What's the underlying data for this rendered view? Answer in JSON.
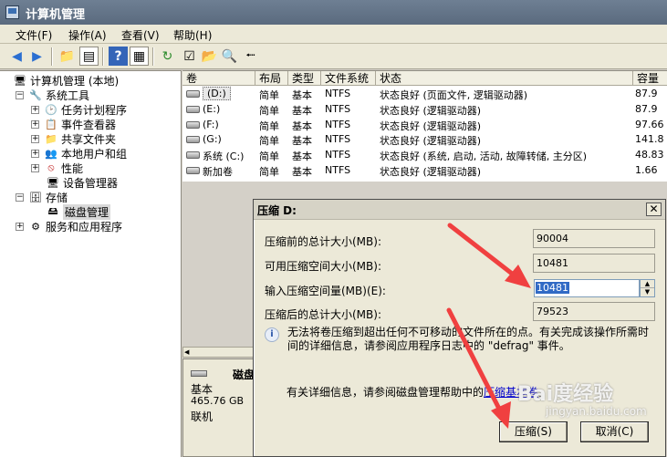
{
  "window": {
    "title": "计算机管理"
  },
  "menu": [
    "文件(F)",
    "操作(A)",
    "查看(V)",
    "帮助(H)"
  ],
  "toolbar_icons": [
    "back-arrow-icon",
    "forward-arrow-icon",
    "folder-up-icon",
    "show-hide-tree-icon",
    "help-icon",
    "properties-icon",
    "refresh-icon",
    "checklist-icon",
    "open-folder-icon",
    "search-icon",
    "export-icon"
  ],
  "tree": {
    "root": "计算机管理 (本地)",
    "system_tools": "系统工具",
    "task_scheduler": "任务计划程序",
    "event_viewer": "事件查看器",
    "shared_folders": "共享文件夹",
    "local_users": "本地用户和组",
    "performance": "性能",
    "device_manager": "设备管理器",
    "storage": "存储",
    "disk_management": "磁盘管理",
    "services": "服务和应用程序"
  },
  "volume_table": {
    "headers": [
      "卷",
      "布局",
      "类型",
      "文件系统",
      "状态",
      "容量"
    ],
    "rows": [
      [
        "(D:)",
        "简单",
        "基本",
        "NTFS",
        "状态良好 (页面文件, 逻辑驱动器)",
        "87.9"
      ],
      [
        "(E:)",
        "简单",
        "基本",
        "NTFS",
        "状态良好 (逻辑驱动器)",
        "87.9"
      ],
      [
        "(F:)",
        "简单",
        "基本",
        "NTFS",
        "状态良好 (逻辑驱动器)",
        "97.66"
      ],
      [
        "(G:)",
        "简单",
        "基本",
        "NTFS",
        "状态良好 (逻辑驱动器)",
        "141.8"
      ],
      [
        "系统 (C:)",
        "简单",
        "基本",
        "NTFS",
        "状态良好 (系统, 启动, 活动, 故障转储, 主分区)",
        "48.83"
      ],
      [
        "新加卷",
        "简单",
        "基本",
        "NTFS",
        "状态良好 (逻辑驱动器)",
        "1.66"
      ]
    ]
  },
  "disk_panel": {
    "title": "磁盘",
    "type": "基本",
    "size": "465.76 GB",
    "status": "联机"
  },
  "dialog": {
    "title": "压缩 D:",
    "close": "✕",
    "total_before_label": "压缩前的总计大小(MB):",
    "total_before_value": "90004",
    "available_label": "可用压缩空间大小(MB):",
    "available_value": "10481",
    "input_label": "输入压缩空间量(MB)(E):",
    "input_value": "10481",
    "total_after_label": "压缩后的总计大小(MB):",
    "total_after_value": "79523",
    "info_text": "无法将卷压缩到超出任何不可移动的文件所在的点。有关完成该操作所需时间的详细信息，请参阅应用程序日志中的 \"defrag\" 事件。",
    "help_prefix": "有关详细信息，请参阅磁盘管理帮助中的",
    "help_link": "压缩基本卷",
    "help_suffix": "。",
    "shrink_button": "压缩(S)",
    "cancel_button": "取消(C)"
  },
  "watermark": {
    "main": "Bai度经验",
    "sub": "jingyan.baidu.com"
  },
  "colors": {
    "selection": "#316ac5",
    "arrow": "#f04040",
    "link": "#0000cc"
  }
}
